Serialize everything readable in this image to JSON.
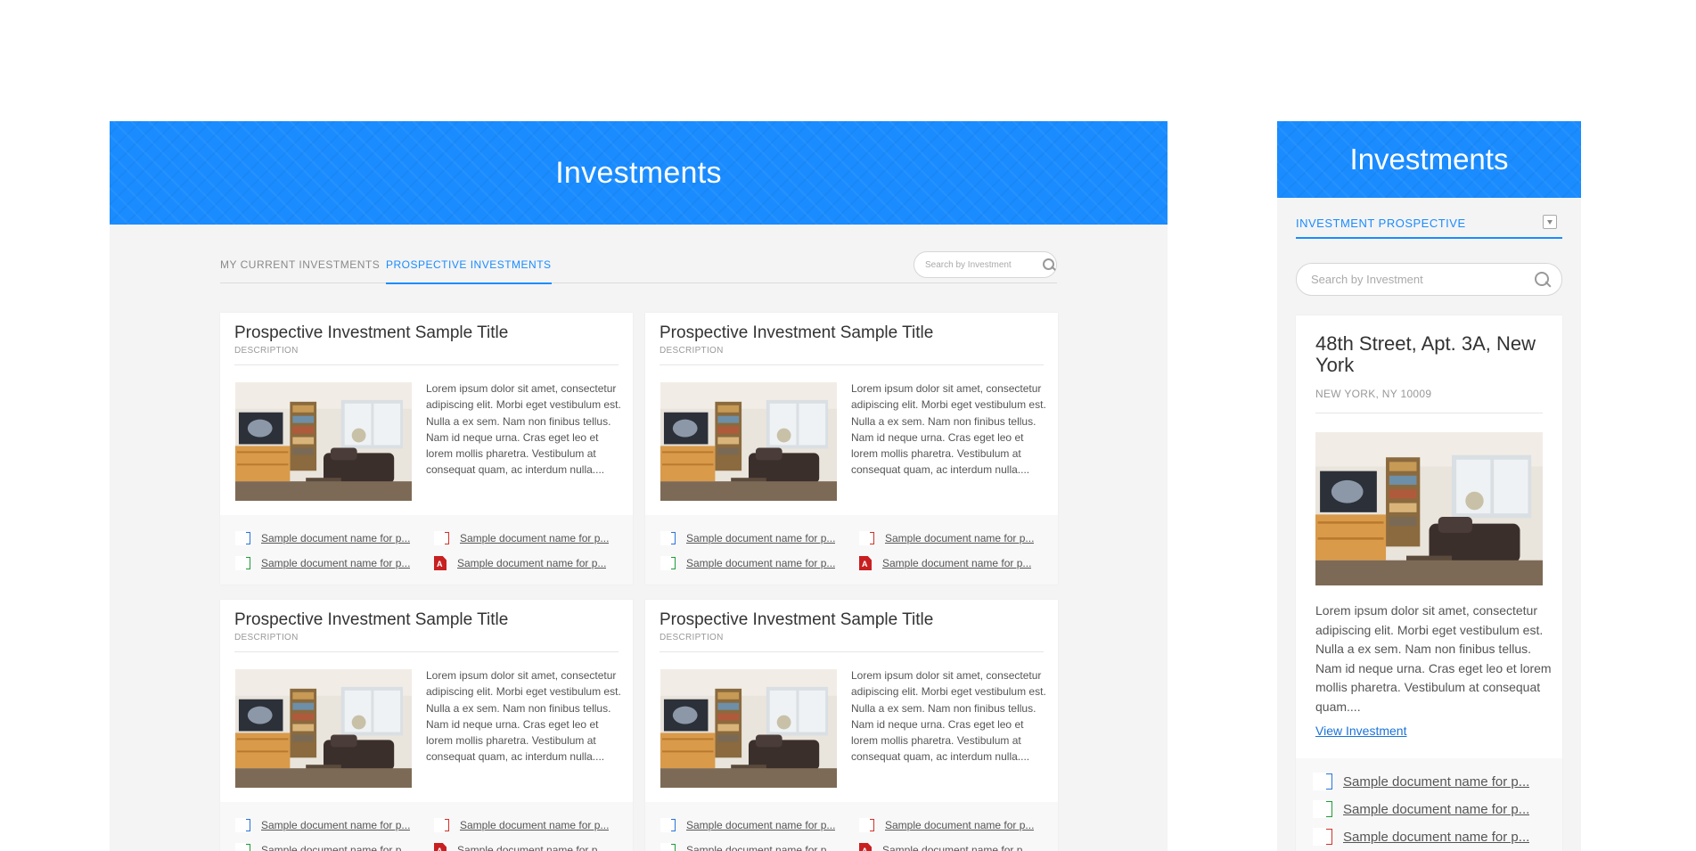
{
  "desktop": {
    "banner_title": "Investments",
    "tabs": [
      {
        "label": "MY CURRENT INVESTMENTS",
        "active": false
      },
      {
        "label": "PROSPECTIVE INVESTMENTS",
        "active": true
      }
    ],
    "search_placeholder": "Search by Investment",
    "cards": [
      {
        "title": "Prospective Investment Sample Title",
        "description": "DESCRIPTION",
        "text": "Lorem ipsum dolor sit amet, consectetur adipiscing elit. Morbi eget vestibulum est. Nulla a ex sem. Nam non finibus tellus. Nam id neque urna. Cras eget leo et lorem mollis pharetra. Vestibulum at consequat quam, ac interdum nulla....",
        "docs": [
          {
            "type": "word",
            "label": "Sample document name for p..."
          },
          {
            "type": "ppt",
            "label": "Sample document name for p..."
          },
          {
            "type": "excel",
            "label": "Sample document name for p..."
          },
          {
            "type": "pdf",
            "label": "Sample document name for p..."
          }
        ]
      },
      {
        "title": "Prospective Investment Sample Title",
        "description": "DESCRIPTION",
        "text": "Lorem ipsum dolor sit amet, consectetur adipiscing elit. Morbi eget vestibulum est. Nulla a ex sem. Nam non finibus tellus. Nam id neque urna. Cras eget leo et lorem mollis pharetra. Vestibulum at consequat quam, ac interdum nulla....",
        "docs": [
          {
            "type": "word",
            "label": "Sample document name for p..."
          },
          {
            "type": "ppt",
            "label": "Sample document name for p..."
          },
          {
            "type": "excel",
            "label": "Sample document name for p..."
          },
          {
            "type": "pdf",
            "label": "Sample document name for p..."
          }
        ]
      },
      {
        "title": "Prospective Investment Sample Title",
        "description": "DESCRIPTION",
        "text": "Lorem ipsum dolor sit amet, consectetur adipiscing elit. Morbi eget vestibulum est. Nulla a ex sem. Nam non finibus tellus. Nam id neque urna. Cras eget leo et lorem mollis pharetra. Vestibulum at consequat quam, ac interdum nulla....",
        "docs": [
          {
            "type": "word",
            "label": "Sample document name for p..."
          },
          {
            "type": "ppt",
            "label": "Sample document name for p..."
          },
          {
            "type": "excel",
            "label": "Sample document name for p..."
          },
          {
            "type": "pdf",
            "label": "Sample document name for p..."
          }
        ]
      },
      {
        "title": "Prospective Investment Sample Title",
        "description": "DESCRIPTION",
        "text": "Lorem ipsum dolor sit amet, consectetur adipiscing elit. Morbi eget vestibulum est. Nulla a ex sem. Nam non finibus tellus. Nam id neque urna. Cras eget leo et lorem mollis pharetra. Vestibulum at consequat quam, ac interdum nulla....",
        "docs": [
          {
            "type": "word",
            "label": "Sample document name for p..."
          },
          {
            "type": "ppt",
            "label": "Sample document name for p..."
          },
          {
            "type": "excel",
            "label": "Sample document name for p..."
          },
          {
            "type": "pdf",
            "label": "Sample document name for p..."
          }
        ]
      }
    ]
  },
  "mobile": {
    "banner_title": "Investments",
    "select_label": "INVESTMENT PROSPECTIVE",
    "search_placeholder": "Search by Investment",
    "card": {
      "title": "48th Street, Apt. 3A, New York",
      "subtitle": "NEW YORK, NY 10009",
      "text": "Lorem ipsum dolor sit amet, consectetur adipiscing elit. Morbi eget vestibulum est. Nulla a ex sem. Nam non finibus tellus. Nam id neque urna. Cras eget leo et lorem mollis pharetra. Vestibulum at consequat quam....",
      "link": "View Investment",
      "docs": [
        {
          "type": "word",
          "label": "Sample document name for p..."
        },
        {
          "type": "excel",
          "label": "Sample document name for p..."
        },
        {
          "type": "ppt",
          "label": "Sample document name for p..."
        }
      ]
    }
  },
  "colors": {
    "brand_blue": "#1a8cff",
    "word": "#2b74d8",
    "excel": "#1f9c3a",
    "ppt": "#d1322a",
    "pdf": "#c82021"
  }
}
